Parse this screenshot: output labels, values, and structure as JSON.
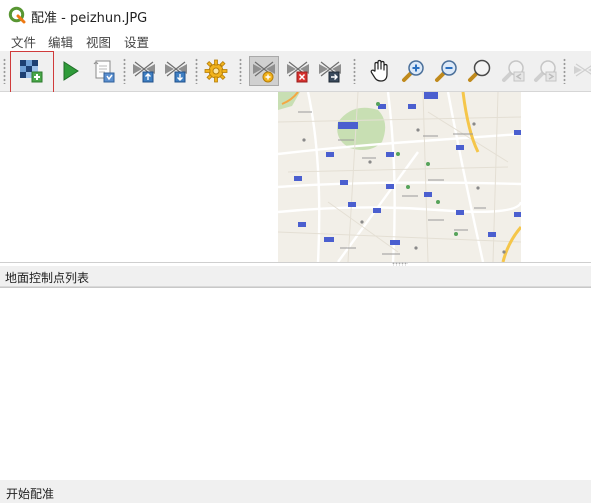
{
  "window": {
    "title": "配准 - peizhun.JPG",
    "app_icon": "qgis-logo-icon"
  },
  "menu": {
    "items": [
      "文件",
      "编辑",
      "视图",
      "设置"
    ]
  },
  "toolbar": {
    "buttons": [
      {
        "name": "open-raster-button",
        "icon": "open-raster-icon",
        "highlighted": true
      },
      {
        "name": "start-georeferencing-button",
        "icon": "play-icon"
      },
      {
        "name": "generate-gdal-script-button",
        "icon": "script-icon"
      },
      {
        "name": "load-gcp-points-button",
        "icon": "load-gcp-icon"
      },
      {
        "name": "save-gcp-points-button",
        "icon": "save-gcp-icon"
      },
      {
        "name": "transformation-settings-button",
        "icon": "gear-icon"
      },
      {
        "name": "add-point-button",
        "icon": "add-point-icon",
        "pressed": true
      },
      {
        "name": "delete-point-button",
        "icon": "delete-point-icon"
      },
      {
        "name": "move-gcp-point-button",
        "icon": "move-point-icon"
      },
      {
        "name": "pan-button",
        "icon": "pan-hand-icon"
      },
      {
        "name": "zoom-in-button",
        "icon": "zoom-in-icon"
      },
      {
        "name": "zoom-out-button",
        "icon": "zoom-out-icon"
      },
      {
        "name": "zoom-to-layer-button",
        "icon": "zoom-to-layer-icon"
      },
      {
        "name": "zoom-last-button",
        "icon": "zoom-last-icon",
        "disabled": true
      },
      {
        "name": "zoom-next-button",
        "icon": "zoom-next-icon",
        "disabled": true
      },
      {
        "name": "link-georeferencer-button",
        "icon": "link-icon",
        "disabled": true
      }
    ]
  },
  "gcp_panel": {
    "title": "地面控制点列表"
  },
  "status": {
    "text": "开始配准"
  },
  "colors": {
    "accent_red": "#d03b3b",
    "toolbar_bg": "#f0f0f0",
    "play_green": "#2f9b3a",
    "map_bg": "#f2efe8"
  }
}
